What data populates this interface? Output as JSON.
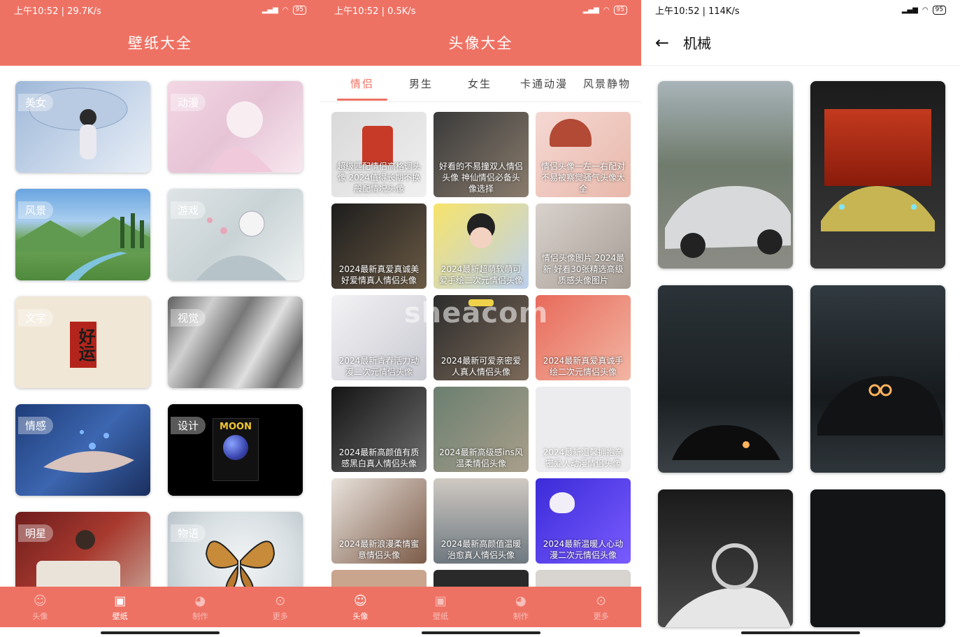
{
  "screen1": {
    "status": {
      "time_speed": "上午10:52 | 29.7K/s",
      "battery": "95"
    },
    "title": "壁纸大全",
    "categories": [
      {
        "label": "美女"
      },
      {
        "label": "动漫"
      },
      {
        "label": "风景"
      },
      {
        "label": "游戏"
      },
      {
        "label": "文字",
        "art_text": "好运"
      },
      {
        "label": "视觉"
      },
      {
        "label": "情感"
      },
      {
        "label": "设计",
        "art_text": "MOON"
      },
      {
        "label": "明星"
      },
      {
        "label": "物语"
      }
    ],
    "nav": [
      {
        "label": "头像",
        "icon": "avatar-icon"
      },
      {
        "label": "壁纸",
        "icon": "wallpaper-icon"
      },
      {
        "label": "制作",
        "icon": "palette-icon"
      },
      {
        "label": "更多",
        "icon": "more-icon"
      }
    ],
    "active_nav": "壁纸"
  },
  "screen2": {
    "status": {
      "time_speed": "上午10:52 | 0.5K/s",
      "battery": "95"
    },
    "title": "头像大全",
    "tabs": [
      "情侣",
      "男生",
      "女生",
      "卡通动漫",
      "风景静物"
    ],
    "active_tab": "情侣",
    "watermark": "sheacom",
    "items": [
      {
        "title": "超级匹配情侣高格调头像 2024值得长期不换般配情况头像"
      },
      {
        "title": "好看的不易撞双人情侣头像 神仙情侣必备头像选择"
      },
      {
        "title": "情侣头像一左一右配对 不易被察觉骚气头像大全"
      },
      {
        "title": "2024最新真爱真诚美好爱情真人情侣头像"
      },
      {
        "title": "2024最新超萌软萌可爱手绘二次元情侣头像"
      },
      {
        "title": "情侣头像图片 2024最新 好看30张精选高级质感头像图片"
      },
      {
        "title": "2024最新青春活力动漫二次元情侣头像"
      },
      {
        "title": "2024最新可爱亲密爱人真人情侣头像"
      },
      {
        "title": "2024最新真爱真诚手绘二次元情侣头像"
      },
      {
        "title": "2024最新高颜值有质感黑白真人情侣头像"
      },
      {
        "title": "2024最新高级感ins风温柔情侣头像"
      },
      {
        "title": "2024最新温馨拥抱亲密爱人动漫情侣头像"
      },
      {
        "title": "2024最新浪漫柔情蜜意情侣头像"
      },
      {
        "title": "2024最新高颜值温暖治愈真人情侣头像"
      },
      {
        "title": "2024最新温暖人心动漫二次元情侣头像"
      }
    ],
    "nav": [
      {
        "label": "头像",
        "icon": "avatar-icon"
      },
      {
        "label": "壁纸",
        "icon": "wallpaper-icon"
      },
      {
        "label": "制作",
        "icon": "palette-icon"
      },
      {
        "label": "更多",
        "icon": "more-icon"
      }
    ],
    "active_nav": "头像"
  },
  "screen3": {
    "status": {
      "time_speed": "上午10:52 | 114K/s",
      "battery": "95"
    },
    "title": "机械",
    "back_icon": "back-arrow-icon",
    "wallpapers": [
      {
        "subject": "silver sports car"
      },
      {
        "subject": "yellow supercar"
      },
      {
        "subject": "dark car front"
      },
      {
        "subject": "dark car headlights"
      },
      {
        "subject": "white hypercar"
      },
      {
        "subject": "dark wallpaper"
      }
    ]
  },
  "colors": {
    "accent": "#ee7264",
    "active_tab": "#ee7264"
  }
}
